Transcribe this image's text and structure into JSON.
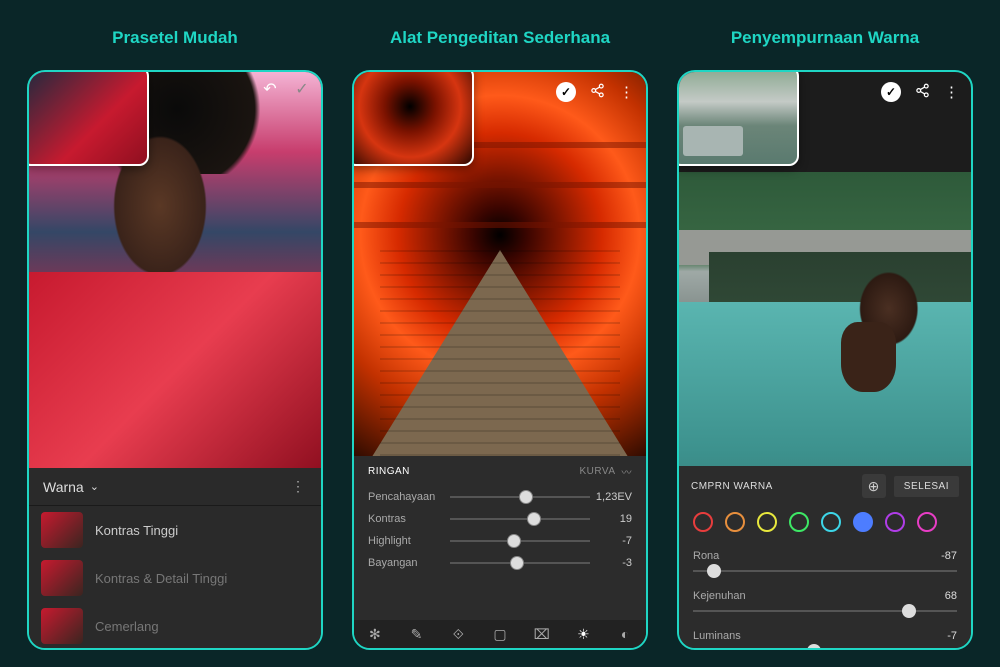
{
  "panel1": {
    "title": "Prasetel Mudah",
    "category_label": "Warna",
    "icons": {
      "undo": "undo-icon",
      "confirm": "check-icon",
      "more": "more-icon"
    },
    "presets": [
      {
        "name": "Kontras Tinggi",
        "active": true
      },
      {
        "name": "Kontras & Detail Tinggi",
        "active": false
      },
      {
        "name": "Cemerlang",
        "active": false
      }
    ]
  },
  "panel2": {
    "title": "Alat Pengeditan Sederhana",
    "tab_active": "RINGAN",
    "tab_secondary": "KURVA",
    "icons": {
      "confirm": "check-circle-icon",
      "share": "share-icon",
      "more": "more-vert-icon"
    },
    "sliders": [
      {
        "label": "Pencahayaan",
        "value": "1,23EV",
        "pos": 54
      },
      {
        "label": "Kontras",
        "value": "19",
        "pos": 60
      },
      {
        "label": "Highlight",
        "value": "-7",
        "pos": 46
      },
      {
        "label": "Bayangan",
        "value": "-3",
        "pos": 48
      }
    ],
    "toolbar": [
      "settings-icon",
      "healing-icon",
      "crop-icon",
      "frame-icon",
      "screen-icon",
      "light-icon",
      "adjust-icon"
    ],
    "toolbar_active_index": 5
  },
  "panel3": {
    "title": "Penyempurnaan Warna",
    "header_label": "CMPRN WARNA",
    "done_label": "SELESAI",
    "icons": {
      "confirm": "check-circle-icon",
      "share": "share-icon",
      "more": "more-vert-icon",
      "target": "target-icon"
    },
    "colors": [
      {
        "hex": "#e83d3d",
        "selected": false
      },
      {
        "hex": "#e88f3d",
        "selected": false
      },
      {
        "hex": "#e8e83d",
        "selected": false
      },
      {
        "hex": "#3de865",
        "selected": false
      },
      {
        "hex": "#3dd6e8",
        "selected": false
      },
      {
        "hex": "#4d7dff",
        "selected": true
      },
      {
        "hex": "#b03de8",
        "selected": false
      },
      {
        "hex": "#e83dc5",
        "selected": false
      }
    ],
    "sliders": [
      {
        "label": "Rona",
        "value": "-87",
        "pos": 8
      },
      {
        "label": "Kejenuhan",
        "value": "68",
        "pos": 82
      },
      {
        "label": "Luminans",
        "value": "-7",
        "pos": 46
      }
    ]
  }
}
